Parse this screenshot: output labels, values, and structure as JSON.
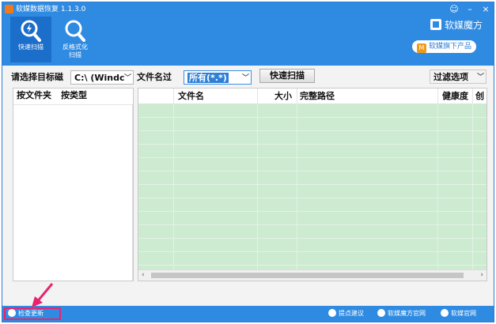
{
  "window": {
    "title": "软媒数据恢复 1.1.3.0",
    "controls": [
      "☺",
      "–",
      "×"
    ]
  },
  "toolbar": {
    "tools": [
      {
        "label": "快速扫描",
        "icon": "quick-scan-icon",
        "active": true
      },
      {
        "label_line1": "反格式化",
        "label_line2": "扫描",
        "icon": "unformat-scan-icon",
        "active": false
      }
    ]
  },
  "brand": {
    "name": "软媒魔方",
    "sub_badge": "M",
    "sub_label": "软媒旗下产品"
  },
  "filters": {
    "disk_label": "请选择目标磁",
    "disk_value": "C:\\ (Windc",
    "filename_label": "文件名过",
    "filename_value": "所有(*.*)",
    "scan_button": "快速扫描",
    "options_button": "过滤选项"
  },
  "left_panel": {
    "tabs": [
      "按文件夹",
      "按类型"
    ]
  },
  "grid": {
    "columns": [
      "文件名",
      "大小",
      "完整路径",
      "健康度",
      "创"
    ],
    "rows": []
  },
  "footer": {
    "check_update": "检查更新",
    "suggest": "提点建议",
    "site1": "软媒魔方官网",
    "site2": "软媒官网"
  },
  "colors": {
    "header_blue": "#2f8be2",
    "grid_green": "#ccebd0",
    "highlight_pink": "#e8236e"
  }
}
